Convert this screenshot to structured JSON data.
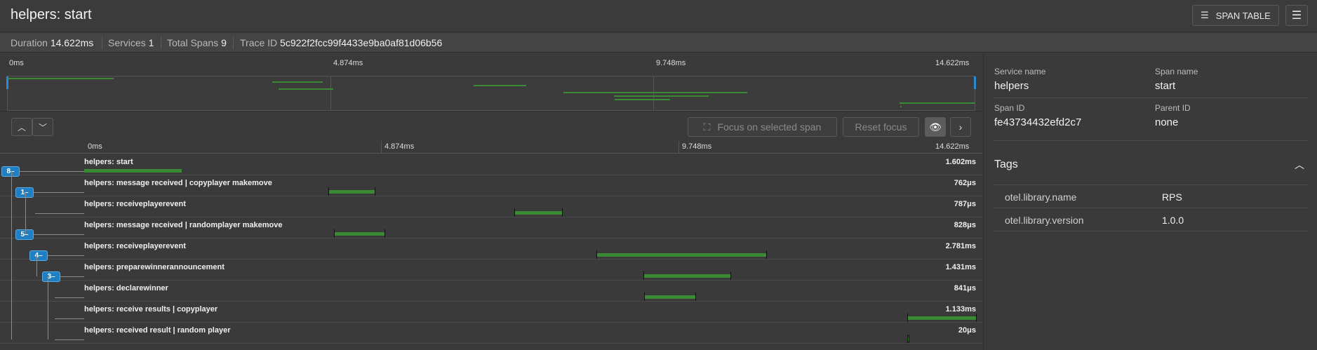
{
  "header": {
    "title": "helpers: start",
    "span_table_label": "SPAN TABLE"
  },
  "meta": {
    "duration_label": "Duration",
    "duration_value": "14.622ms",
    "services_label": "Services",
    "services_value": "1",
    "total_spans_label": "Total Spans",
    "total_spans_value": "9",
    "trace_id_label": "Trace ID",
    "trace_id_value": "5c922f2fcc99f4433e9ba0af81d06b56"
  },
  "timeline": {
    "total_ms": 14.622,
    "ticks": [
      "0ms",
      "4.874ms",
      "9.748ms",
      "14.622ms"
    ],
    "focus_label": "Focus on selected span",
    "reset_label": "Reset focus",
    "spans": [
      {
        "name": "helpers: start",
        "duration": "1.602ms",
        "start_ms": 0.0,
        "dur_ms": 1.602,
        "badge": "8",
        "depth": 0
      },
      {
        "name": "helpers: message received | copyplayer makemove",
        "duration": "762μs",
        "start_ms": 4.0,
        "dur_ms": 0.762,
        "badge": "1",
        "depth": 1
      },
      {
        "name": "helpers: receiveplayerevent",
        "duration": "787μs",
        "start_ms": 7.05,
        "dur_ms": 0.787,
        "badge": "",
        "depth": 2
      },
      {
        "name": "helpers: message received | randomplayer makemove",
        "duration": "828μs",
        "start_ms": 4.1,
        "dur_ms": 0.828,
        "badge": "5",
        "depth": 1
      },
      {
        "name": "helpers: receiveplayerevent",
        "duration": "2.781ms",
        "start_ms": 8.4,
        "dur_ms": 2.781,
        "badge": "4",
        "depth": 2
      },
      {
        "name": "helpers: preparewinnerannouncement",
        "duration": "1.431ms",
        "start_ms": 9.17,
        "dur_ms": 1.431,
        "badge": "3",
        "depth": 3
      },
      {
        "name": "helpers: declarewinner",
        "duration": "841μs",
        "start_ms": 9.18,
        "dur_ms": 0.841,
        "badge": "",
        "depth": 4
      },
      {
        "name": "helpers: receive results | copyplayer",
        "duration": "1.133ms",
        "start_ms": 13.489,
        "dur_ms": 1.133,
        "badge": "",
        "depth": 4
      },
      {
        "name": "helpers: received result | random player",
        "duration": "20μs",
        "start_ms": 13.5,
        "dur_ms": 0.02,
        "badge": "",
        "depth": 4
      }
    ]
  },
  "details": {
    "service_name_label": "Service name",
    "service_name_value": "helpers",
    "span_name_label": "Span name",
    "span_name_value": "start",
    "span_id_label": "Span ID",
    "span_id_value": "fe43734432efd2c7",
    "parent_id_label": "Parent ID",
    "parent_id_value": "none",
    "tags_title": "Tags",
    "tags": [
      {
        "key": "otel.library.name",
        "value": "RPS"
      },
      {
        "key": "otel.library.version",
        "value": "1.0.0"
      }
    ]
  },
  "colors": {
    "bar": "#3a8a35",
    "badge": "#1f7fc2"
  }
}
